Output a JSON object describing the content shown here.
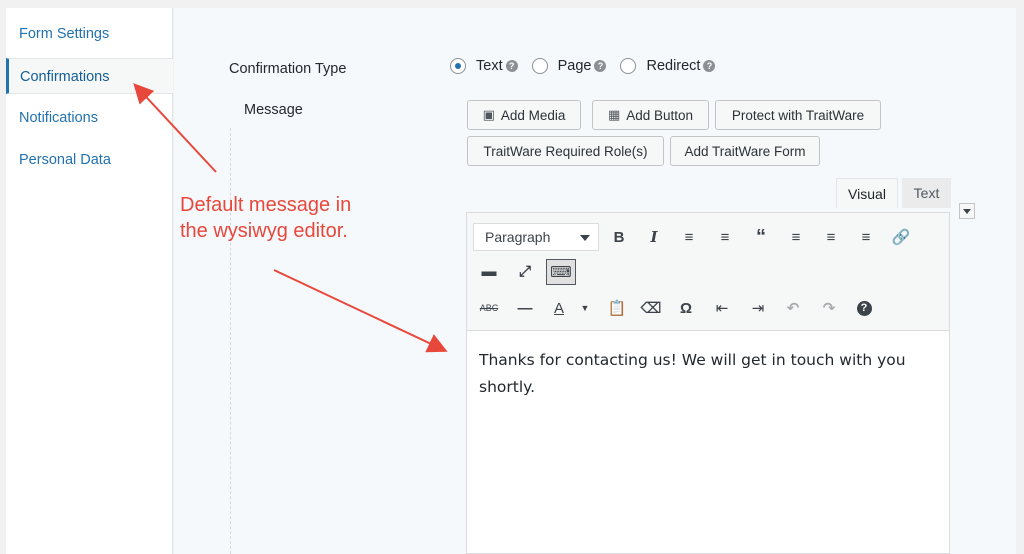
{
  "sidebar": {
    "items": [
      {
        "label": "Form Settings"
      },
      {
        "label": "Confirmations"
      },
      {
        "label": "Notifications"
      },
      {
        "label": "Personal Data"
      }
    ]
  },
  "confirmation": {
    "type_label": "Confirmation Type",
    "options": [
      {
        "label": "Text",
        "checked": true
      },
      {
        "label": "Page",
        "checked": false
      },
      {
        "label": "Redirect",
        "checked": false
      }
    ],
    "message_label": "Message"
  },
  "media_buttons": {
    "add_media": "Add Media",
    "add_button": "Add Button",
    "protect": "Protect with TraitWare",
    "required_roles": "TraitWare Required Role(s)",
    "add_form": "Add TraitWare Form"
  },
  "editor_tabs": {
    "visual": "Visual",
    "text": "Text"
  },
  "editor": {
    "format_select": "Paragraph",
    "content": "Thanks for contacting us! We will get in touch with you shortly."
  },
  "annotation": {
    "line1": "Default message in",
    "line2": "the wysiwyg editor.",
    "color": "#e8473b"
  }
}
